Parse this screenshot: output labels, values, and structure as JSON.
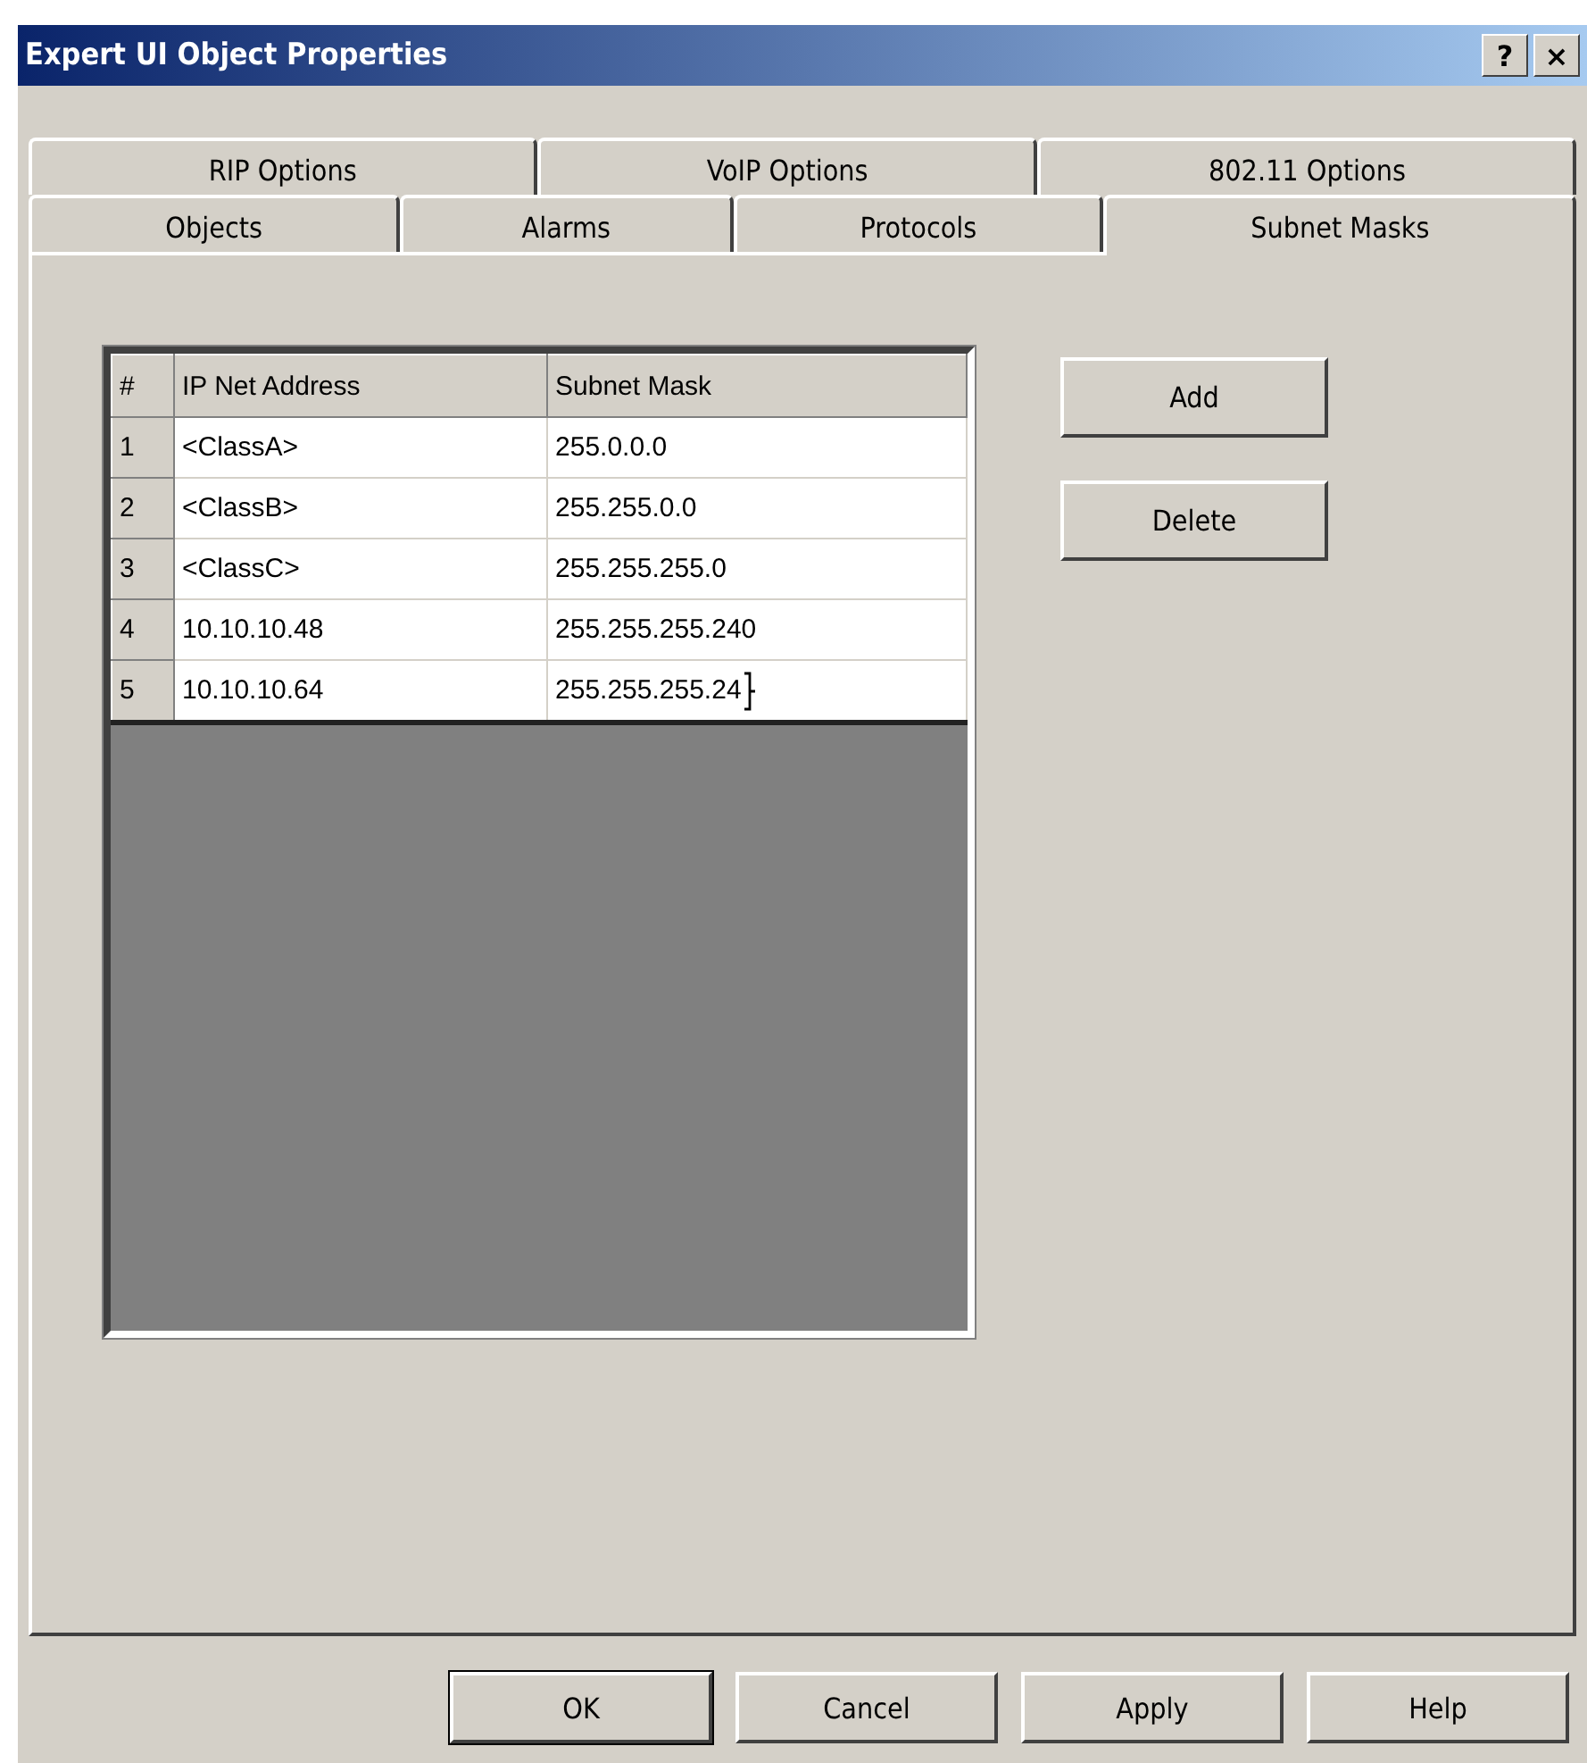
{
  "window": {
    "title": "Expert UI Object Properties",
    "title_buttons": [
      "?",
      "×"
    ]
  },
  "tab_rows": [
    [
      {
        "label": "RIP Options",
        "selected": false
      },
      {
        "label": "VoIP Options",
        "selected": false
      },
      {
        "label": "802.11 Options",
        "selected": false
      }
    ],
    [
      {
        "label": "Objects",
        "selected": false
      },
      {
        "label": "Alarms",
        "selected": false
      },
      {
        "label": "Protocols",
        "selected": false
      },
      {
        "label": "Subnet Masks",
        "selected": true
      }
    ]
  ],
  "table": {
    "columns": [
      "#",
      "IP Net Address",
      "Subnet Mask"
    ],
    "rows": [
      {
        "cells": [
          "1",
          "<ClassA>",
          "255.0.0.0"
        ],
        "editing": false
      },
      {
        "cells": [
          "2",
          "<ClassB>",
          "255.255.0.0"
        ],
        "editing": false
      },
      {
        "cells": [
          "3",
          "<ClassC>",
          "255.255.255.0"
        ],
        "editing": false
      },
      {
        "cells": [
          "4",
          "10.10.10.48",
          "255.255.255.240"
        ],
        "editing": false
      },
      {
        "cells": [
          "5",
          "10.10.10.64",
          "255.255.255.24"
        ],
        "editing": true
      }
    ]
  },
  "side_buttons": [
    "Add",
    "Delete"
  ],
  "buttons": [
    {
      "label": "OK",
      "default": true
    },
    {
      "label": "Cancel",
      "default": false
    },
    {
      "label": "Apply",
      "default": false
    },
    {
      "label": "Help",
      "default": false
    }
  ]
}
